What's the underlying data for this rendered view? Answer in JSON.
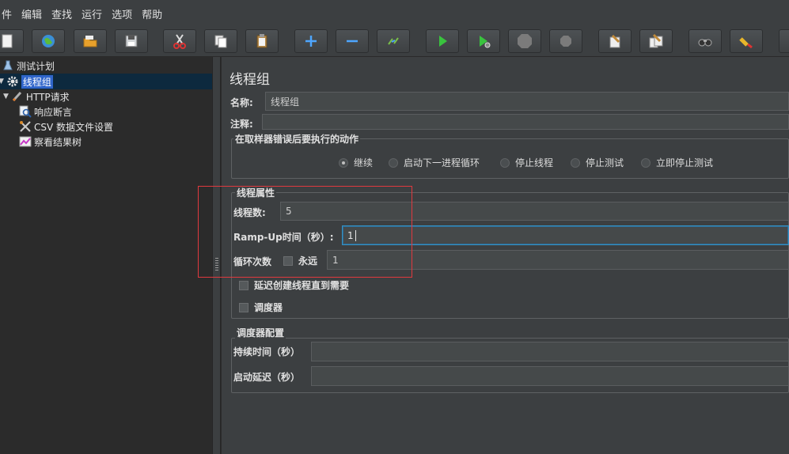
{
  "menu": [
    "件",
    "编辑",
    "查找",
    "运行",
    "选项",
    "帮助"
  ],
  "toolbar": {
    "buttons": [
      {
        "name": "new-icon"
      },
      {
        "name": "templates-icon"
      },
      {
        "name": "open-icon"
      },
      {
        "name": "save-icon"
      },
      {
        "name": "cut-icon"
      },
      {
        "name": "copy-icon"
      },
      {
        "name": "paste-icon"
      },
      {
        "name": "expand-icon"
      },
      {
        "name": "collapse-icon"
      },
      {
        "name": "toggle-icon"
      },
      {
        "name": "start-icon"
      },
      {
        "name": "start-no-pause-icon"
      },
      {
        "name": "stop-icon"
      },
      {
        "name": "shutdown-icon"
      },
      {
        "name": "clear-icon"
      },
      {
        "name": "clear-all-icon"
      },
      {
        "name": "search-icon"
      },
      {
        "name": "reset-search-icon"
      }
    ]
  },
  "tree": {
    "items": [
      {
        "label": "测试计划",
        "icon": "test-plan-icon"
      },
      {
        "label": "线程组",
        "icon": "gear-icon"
      },
      {
        "label": "HTTP请求",
        "icon": "pen-icon"
      },
      {
        "label": "响应断言",
        "icon": "magnifier-icon"
      },
      {
        "label": "CSV 数据文件设置",
        "icon": "tools-icon"
      },
      {
        "label": "察看结果树",
        "icon": "chart-icon"
      }
    ]
  },
  "panel": {
    "title": "线程组",
    "name_label": "名称:",
    "name_value": "线程组",
    "comment_label": "注释:",
    "comment_value": "",
    "error_action": {
      "title": "在取样器错误后要执行的动作",
      "options": [
        "继续",
        "启动下一进程循环",
        "停止线程",
        "停止测试",
        "立即停止测试"
      ],
      "selected": "继续"
    },
    "thread_props": {
      "title": "线程属性",
      "threads_label": "线程数:",
      "threads_value": "5",
      "rampup_label": "Ramp-Up时间（秒）:",
      "rampup_value": "1",
      "loop_label": "循环次数",
      "forever_label": "永远",
      "loop_value": "1",
      "delay_label": "延迟创建线程直到需要",
      "scheduler_label": "调度器"
    },
    "scheduler_config": {
      "title": "调度器配置",
      "duration_label": "持续时间（秒）",
      "duration_value": "",
      "delay_label": "启动延迟（秒）",
      "delay_value": ""
    }
  },
  "colors": {
    "accent": "#3592c4",
    "selection": "#2f65ca",
    "highlight_box": "#e0393e"
  }
}
